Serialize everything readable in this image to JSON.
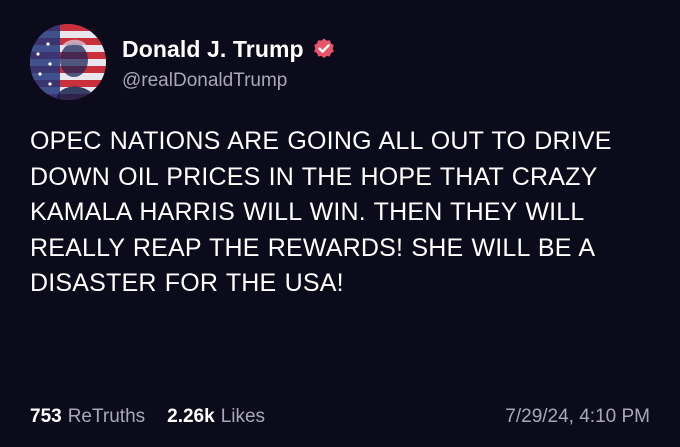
{
  "post": {
    "author": {
      "display_name": "Donald J. Trump",
      "handle": "@realDonaldTrump",
      "verified_icon": "verified-badge-icon",
      "avatar_icon": "avatar-portrait-flag"
    },
    "text": "OPEC NATIONS ARE GOING ALL OUT TO DRIVE DOWN OIL PRICES IN THE HOPE THAT CRAZY KAMALA HARRIS WILL WIN. THEN THEY WILL REALLY REAP THE REWARDS! SHE WILL BE A DISASTER FOR THE USA!",
    "stats": {
      "retruths_count": "753",
      "retruths_label": "ReTruths",
      "likes_count": "2.26k",
      "likes_label": "Likes"
    },
    "timestamp": "7/29/24, 4:10 PM"
  },
  "colors": {
    "background": "#0c0b1b",
    "primary_text": "#ffffff",
    "secondary_text": "#a9a7b8",
    "verified_badge": "#e8556b"
  }
}
